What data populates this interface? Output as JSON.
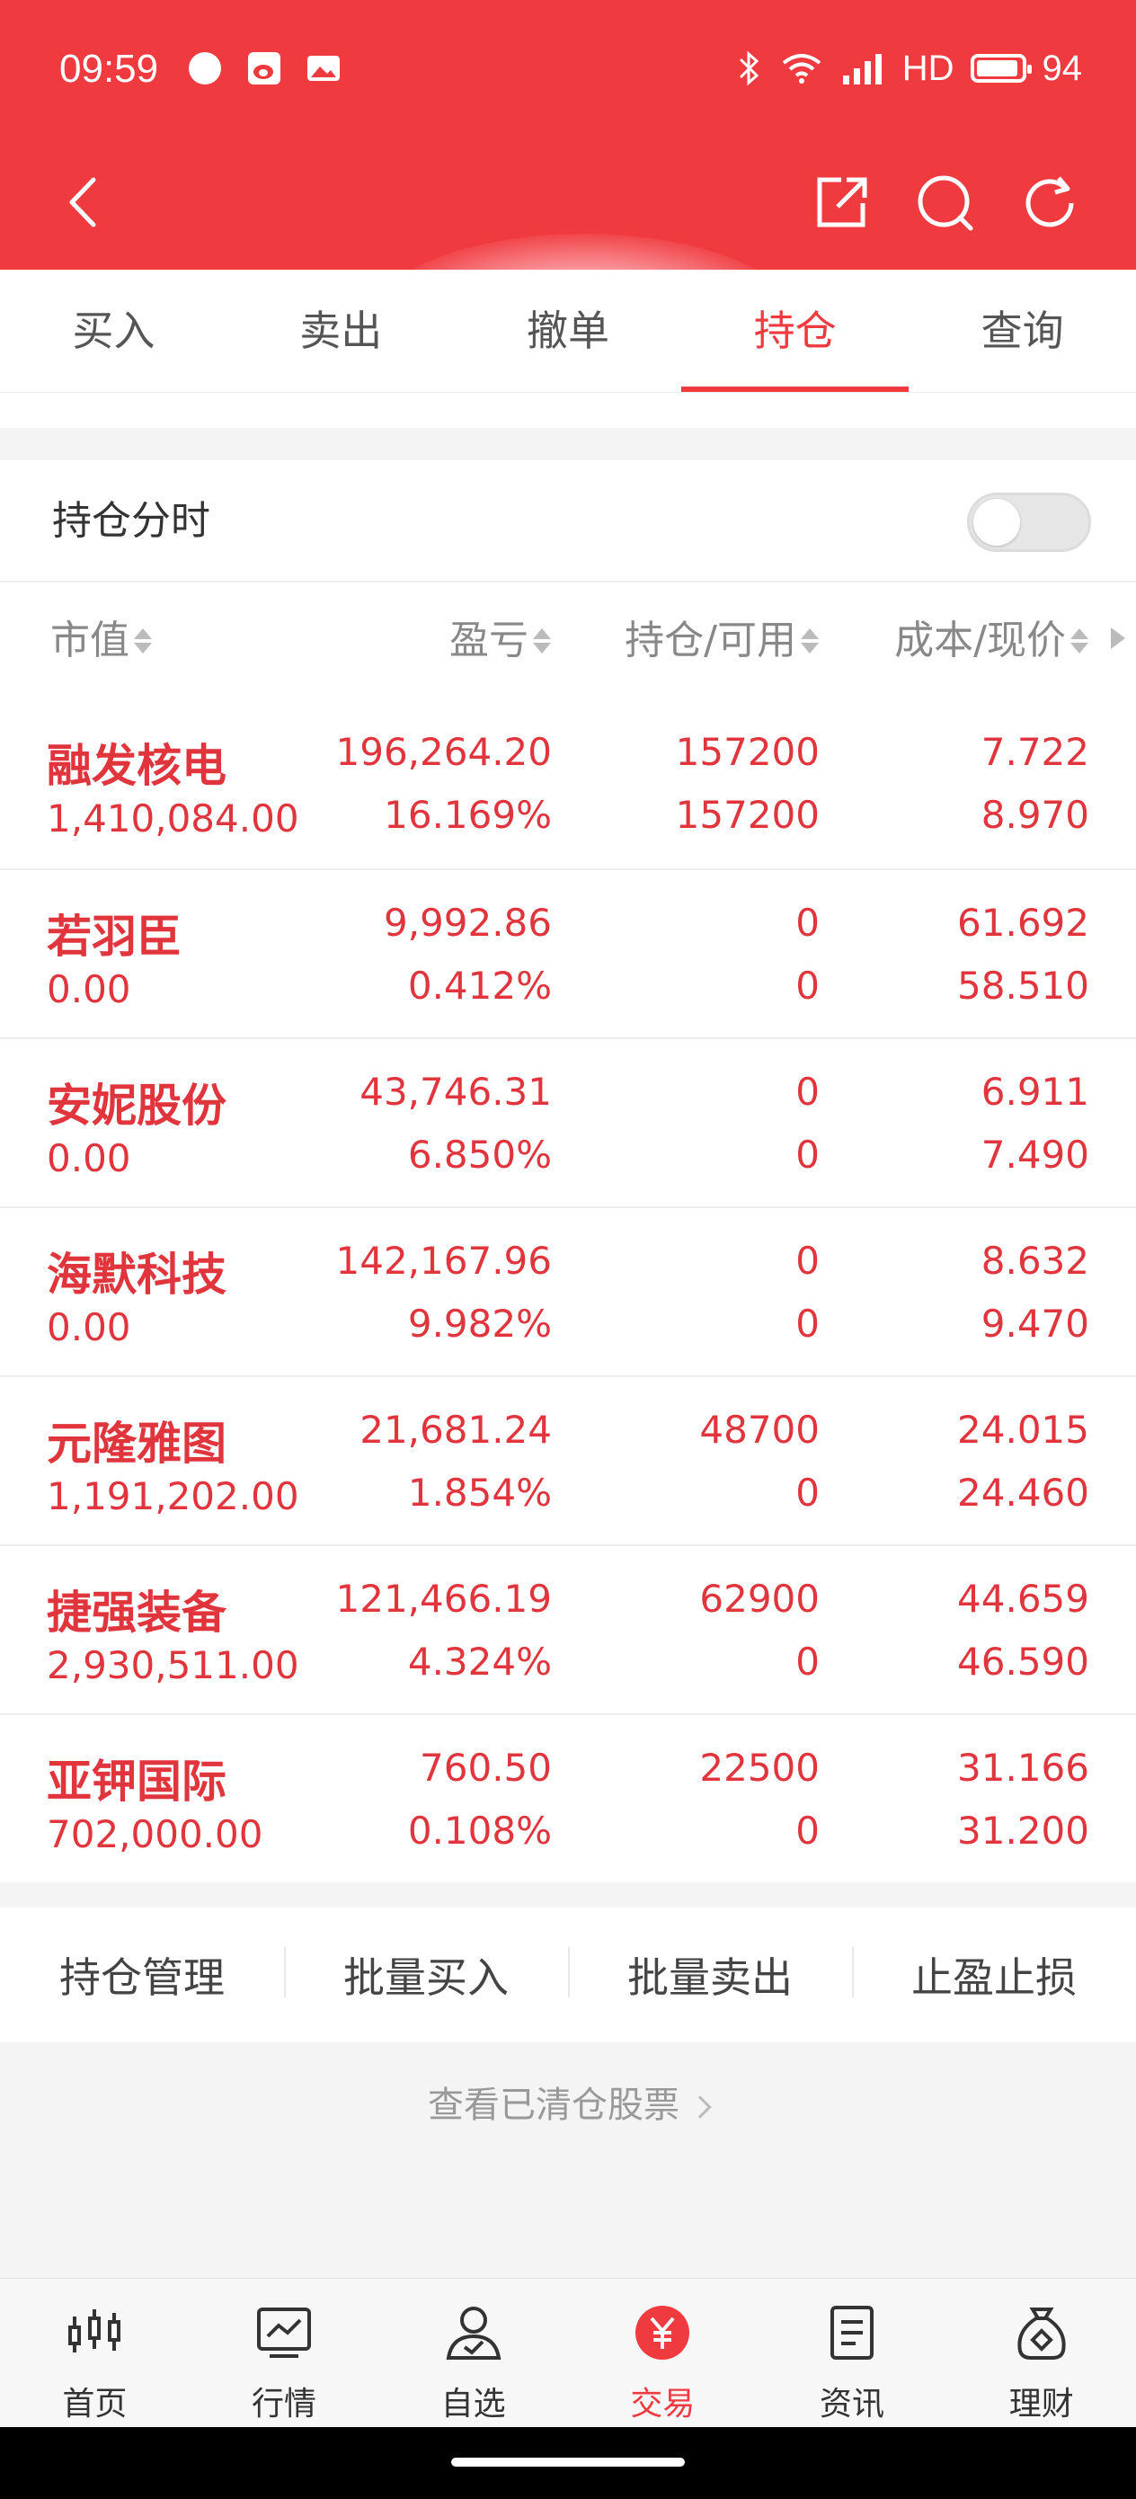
{
  "status_bar": {
    "time": "09:59",
    "network": "HD",
    "battery": "94",
    "battery_level": 0.94
  },
  "tabs": [
    {
      "label": "买入",
      "active": false
    },
    {
      "label": "卖出",
      "active": false
    },
    {
      "label": "撤单",
      "active": false
    },
    {
      "label": "持仓",
      "active": true
    },
    {
      "label": "查询",
      "active": false
    }
  ],
  "fenshi": {
    "label": "持仓分时",
    "toggle_on": false
  },
  "table": {
    "headers": [
      "市值",
      "盈亏",
      "持仓/可用",
      "成本/现价"
    ],
    "rows": [
      {
        "name": "融发核电",
        "market_value": "1,410,084.00",
        "pnl": "196,264.20",
        "pnl_pct": "16.169%",
        "holding": "157200",
        "available": "157200",
        "cost": "7.722",
        "price": "8.970"
      },
      {
        "name": "若羽臣",
        "market_value": "0.00",
        "pnl": "9,992.86",
        "pnl_pct": "0.412%",
        "holding": "0",
        "available": "0",
        "cost": "61.692",
        "price": "58.510"
      },
      {
        "name": "安妮股份",
        "market_value": "0.00",
        "pnl": "43,746.31",
        "pnl_pct": "6.850%",
        "holding": "0",
        "available": "0",
        "cost": "6.911",
        "price": "7.490"
      },
      {
        "name": "海默科技",
        "market_value": "0.00",
        "pnl": "142,167.96",
        "pnl_pct": "9.982%",
        "holding": "0",
        "available": "0",
        "cost": "8.632",
        "price": "9.470"
      },
      {
        "name": "元隆雅图",
        "market_value": "1,191,202.00",
        "pnl": "21,681.24",
        "pnl_pct": "1.854%",
        "holding": "48700",
        "available": "0",
        "cost": "24.015",
        "price": "24.460"
      },
      {
        "name": "捷强装备",
        "market_value": "2,930,511.00",
        "pnl": "121,466.19",
        "pnl_pct": "4.324%",
        "holding": "62900",
        "available": "0",
        "cost": "44.659",
        "price": "46.590"
      },
      {
        "name": "亚钾国际",
        "market_value": "702,000.00",
        "pnl": "760.50",
        "pnl_pct": "0.108%",
        "holding": "22500",
        "available": "0",
        "cost": "31.166",
        "price": "31.200"
      }
    ]
  },
  "actions": [
    "持仓管理",
    "批量买入",
    "批量卖出",
    "止盈止损"
  ],
  "cleared_link": "查看已清仓股票",
  "bottom_nav": [
    {
      "label": "首页",
      "icon": "candlestick-icon",
      "active": false
    },
    {
      "label": "行情",
      "icon": "market-chart-icon",
      "active": false
    },
    {
      "label": "自选",
      "icon": "user-check-icon",
      "active": false
    },
    {
      "label": "交易",
      "icon": "yen-icon",
      "active": true
    },
    {
      "label": "资讯",
      "icon": "document-icon",
      "active": false
    },
    {
      "label": "理财",
      "icon": "money-bag-icon",
      "active": false
    }
  ],
  "colors": {
    "brand_red": "#ef3a3f",
    "value_red": "#e0353c"
  }
}
